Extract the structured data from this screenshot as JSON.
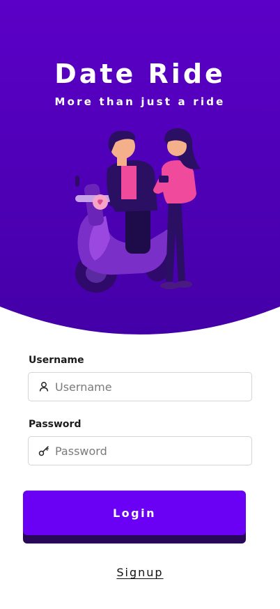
{
  "app": {
    "title": "Date Ride",
    "tagline": "More than just a ride"
  },
  "colors": {
    "hero_top": "#5a00c4",
    "hero_bottom": "#4500aa",
    "button": "#6a00f4",
    "button_shadow": "#2a0859",
    "accent_pink": "#ef4a9b"
  },
  "hero": {
    "illustration": "couple-scooter-illustration"
  },
  "form": {
    "username": {
      "label": "Username",
      "placeholder": "Username",
      "icon": "user-icon"
    },
    "password": {
      "label": "Password",
      "placeholder": "Password",
      "icon": "key-icon"
    },
    "login_label": "Login",
    "signup_label": "Signup"
  }
}
